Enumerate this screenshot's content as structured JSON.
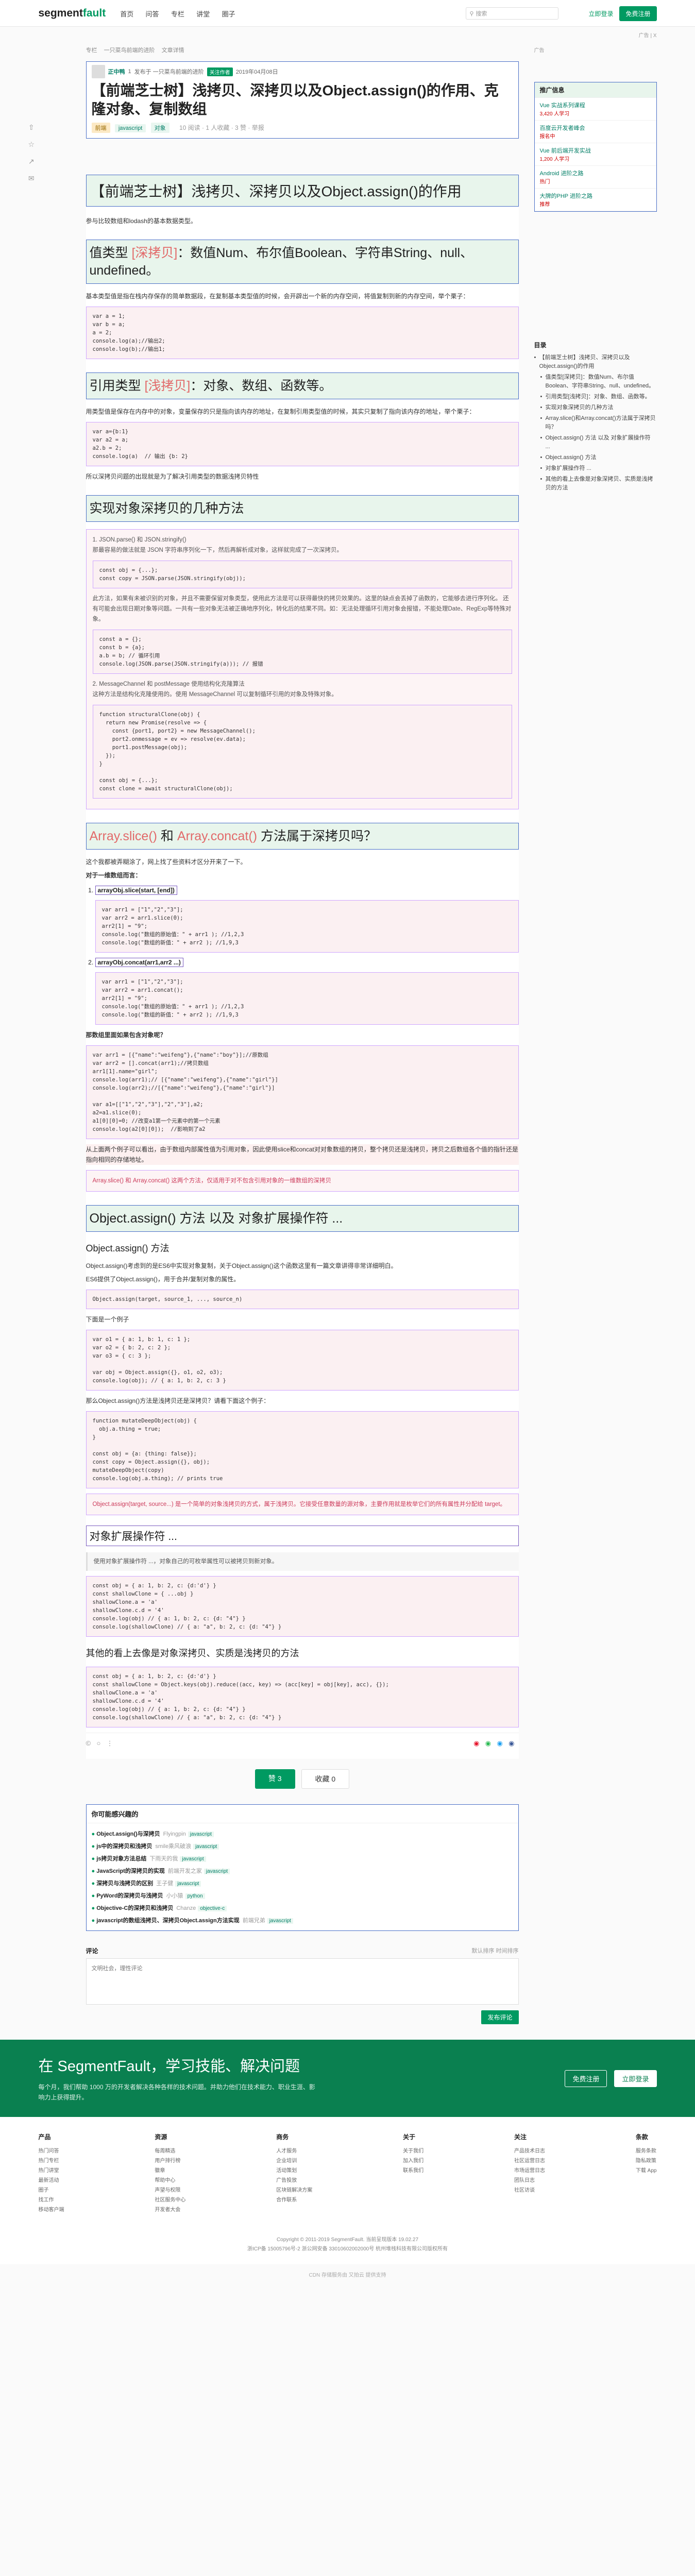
{
  "header": {
    "logo_a": "segment",
    "logo_b": "fault",
    "nav": [
      "首页",
      "问答",
      "专栏",
      "讲堂",
      "圈子"
    ],
    "search_placeholder": "搜索",
    "login": "立即登录",
    "register": "免费注册",
    "ad_tip": "广告 | X"
  },
  "crumb": [
    "专栏",
    "一只菜鸟前端的进阶",
    "文章详情"
  ],
  "post": {
    "author": "正中鸭",
    "rep": "1",
    "follow": "关注作者",
    "meta": "发布于 一只菜鸟前端的进阶",
    "date": "2019年04月08日",
    "title": "【前端芝士树】浅拷贝、深拷贝以及Object.assign()的作用、克隆对象、复制数组",
    "tags": [
      "前端",
      "javascript",
      "对象"
    ],
    "stats": "10 阅读  · 1 人收藏 · 3 赞  · 举报"
  },
  "article": {
    "h1": "【前端芝士树】浅拷贝、深拷贝以及Object.assign()的作用",
    "intro": "参与比较数组和lodash的基本数据类型。",
    "s1_title": "值类型 ",
    "s1_hl": "[深拷贝]",
    "s1_rest": "：数值Num、布尔值Boolean、字符串String、null、undefined。",
    "s1_text": "基本类型值是指在栈内存保存的简单数据段，在复制基本类型值的时候，会开辟出一个新的内存空间，将值复制到新的内存空间，举个栗子：",
    "s1_code": "var a = 1;\nvar b = a;\na = 2;\nconsole.log(a);//输出2;\nconsole.log(b);//输出1;",
    "s2_title": "引用类型 ",
    "s2_hl": "[浅拷贝]",
    "s2_rest": "：对象、数组、函数等。",
    "s2_text": "用类型值是保存在内存中的对象，变量保存的只是指向该内存的地址，在复制引用类型值的时候，其实只复制了指向该内存的地址，举个栗子：",
    "s2_code": "var a={b:1}\nvar a2 = a;\na2.b = 2;\nconsole.log(a)  // 输出 {b: 2}",
    "s2_after": "所以深拷贝问题的出现就是为了解决引用类型的数据浅拷贝特性",
    "s3_title": "实现对象深拷贝的几种方法",
    "s3_q1": "1. JSON.parse() 和 JSON.stringify()\n那最容易的做法就是 JSON 字符串序列化一下，然后再解析成对象，这样就完成了一次深拷贝。",
    "s3_code1": "const obj = {...};\nconst copy = JSON.parse(JSON.stringify(obj));",
    "s3_q2": "此方法，如果有未被识别的对象，并且不需要保留对象类型，使用此方法是可以获得最快的拷贝效果的。这里的缺点会丢掉了函数的，它能够去进行序列化。 还有可能会出现日期对象等问题。一共有一些对象无法被正确地序列化，转化后的结果不同。如：无法处理循环引用对象会报错，不能处理Date、RegExp等特殊对象。",
    "s3_code2": "const a = {};\nconst b = {a};\na.b = b; // 循环引用\nconsole.log(JSON.parse(JSON.stringify(a))); // 报错",
    "s3_q3": "2. MessageChannel 和 postMessage 使用结构化克隆算法\n这种方法是结构化克隆使用的。使用 MessageChannel 可以复制循环引用的对象及特殊对象。",
    "s3_code3": "function structuralClone(obj) {\n  return new Promise(resolve => {\n    const {port1, port2} = new MessageChannel();\n    port2.onmessage = ev => resolve(ev.data);\n    port1.postMessage(obj);\n  });\n}\n\nconst obj = {...};\nconst clone = await structuralClone(obj);",
    "s4_title_a": "Array.slice()",
    "s4_mid": " 和 ",
    "s4_title_b": "Array.concat()",
    "s4_rest": " 方法属于深拷贝吗？",
    "s4_text": "这个我都被弄糊涂了，网上找了些资料才区分开来了一下。",
    "s4_text2": "对于一维数组而言：",
    "s4_item1": "arrayObj.slice(start, [end])",
    "s4_code1": "var arr1 = [\"1\",\"2\",\"3\"];\nvar arr2 = arr1.slice(0);\narr2[1] = \"9\";\nconsole.log(\"数组的原始值：\" + arr1 ); //1,2,3\nconsole.log(\"数组的新值：\" + arr2 ); //1,9,3",
    "s4_item2": "arrayObj.concat(arr1,arr2 ...)",
    "s4_code2": "var arr1 = [\"1\",\"2\",\"3\"];\nvar arr2 = arr1.concat();\narr2[1] = \"9\";\nconsole.log(\"数组的原始值：\" + arr1 ); //1,2,3\nconsole.log(\"数组的新值：\" + arr2 ); //1,9,3",
    "s4_text3": "那数组里面如果包含对象呢？",
    "s4_code3": "var arr1 = [{\"name\":\"weifeng\"},{\"name\":\"boy\"}];//原数组\nvar arr2 = [].concat(arr1);//拷贝数组\narr1[1].name=\"girl\";\nconsole.log(arr1);// [{\"name\":\"weifeng\"},{\"name\":\"girl\"}]\nconsole.log(arr2);//[{\"name\":\"weifeng\"},{\"name\":\"girl\"}]\n\nvar a1=[[\"1\",\"2\",\"3\"],\"2\",\"3\"],a2;\na2=a1.slice(0);\na1[0][0]=0; //改变a1第一个元素中的第一个元素\nconsole.log(a2[0][0]);  //影响到了a2",
    "s4_text4": "从上面两个例子可以看出，由于数组内部属性值为引用对象，因此使用slice和concat对对象数组的拷贝，整个拷贝还是浅拷贝，拷贝之后数组各个值的指针还是指向相同的存储地址。",
    "s4_tip": "Array.slice() 和 Array.concat() 这两个方法，仅适用于对不包含引用对象的一维数组的深拷贝",
    "s5_title": "Object.assign() 方法 以及 对象扩展操作符 ...",
    "s5_sub": "Object.assign() 方法",
    "s5_text": "Object.assign()考虑到的是ES6中实现对象复制，关于Object.assign()这个函数这里有一篇文章讲得非常详细明白。",
    "s5_text2": "ES6提供了Object.assign()，用于合并/复制对象的属性。",
    "s5_code1": "Object.assign(target, source_1, ..., source_n)",
    "s5_text3": "下面是一个例子",
    "s5_code2": "var o1 = { a: 1, b: 1, c: 1 };\nvar o2 = { b: 2, c: 2 };\nvar o3 = { c: 3 };\n\nvar obj = Object.assign({}, o1, o2, o3);\nconsole.log(obj); // { a: 1, b: 2, c: 3 }",
    "s5_text4": "那么Object.assign()方法是浅拷贝还是深拷贝？请看下面这个例子：",
    "s5_code3": "function mutateDeepObject(obj) {\n  obj.a.thing = true;\n}\n\nconst obj = {a: {thing: false}};\nconst copy = Object.assign({}, obj);\nmutateDeepObject(copy)\nconsole.log(obj.a.thing); // prints true",
    "s5_tip": "Object.assign(target, source...) 是一个简单的对象浅拷贝的方式，属于浅拷贝。它接受任意数量的源对象，主要作用就是枚举它们的所有属性并分配给 target。",
    "s6_title": "对象扩展操作符 ...",
    "s6_q": "使用对象扩展操作符 ...，对象自己的可枚举属性可以被拷贝到新对象。",
    "s6_code": "const obj = { a: 1, b: 2, c: {d:'d'} }\nconst shallowClone = { ...obj }\nshallowClone.a = 'a'\nshallowClone.c.d = '4'\nconsole.log(obj) // { a: 1, b: 2, c: {d: \"4\"} }\nconsole.log(shallowClone) // { a: \"a\", b: 2, c: {d: \"4\"} }",
    "s7_title": "其他的看上去像是对象深拷贝、实质是浅拷贝的方法",
    "s7_code": "const obj = { a: 1, b: 2, c: {d:'d'} }\nconst shallowClone = Object.keys(obj).reduce((acc, key) => (acc[key] = obj[key], acc), {});\nshallowClone.a = 'a'\nshallowClone.c.d = '4'\nconsole.log(obj) // { a: 1, b: 2, c: {d: \"4\"} }\nconsole.log(shallowClone) // { a: \"a\", b: 2, c: {d: \"4\"} }"
  },
  "actions": {
    "vote": "赞 3",
    "fav": "收藏 0"
  },
  "related": {
    "title": "你可能感兴趣的",
    "items": [
      {
        "t": "Object.assign()与深拷贝",
        "a": "Flyingpin",
        "tag": "javascript"
      },
      {
        "t": "js中的深拷贝和浅拷贝",
        "a": "smile乘风破浪",
        "tag": "javascript"
      },
      {
        "t": "js拷贝对象方法总结",
        "a": "下雨天的我",
        "tag": "javascript"
      },
      {
        "t": "JavaScript的深拷贝的实现",
        "a": "前端开发之家",
        "tag": "javascript"
      },
      {
        "t": "深拷贝与浅拷贝的区别",
        "a": "王子健",
        "tag": "javascript"
      },
      {
        "t": "PyWord的深拷贝与浅拷贝",
        "a": "小小猿",
        "tag": "python"
      },
      {
        "t": "Objective-C的深拷贝和浅拷贝",
        "a": "Chanze",
        "tag": "objective-c"
      },
      {
        "t": "javascript的数组浅拷贝、深拷贝Object.assign方法实现",
        "a": "前端兄弟",
        "tag": "javascript"
      }
    ]
  },
  "comment": {
    "title": "评论",
    "sort": "默认排序 时间排序",
    "placeholder": "文明社会，理性评论",
    "publish": "发布评论"
  },
  "side": {
    "ad": "广告",
    "rec_title": "推广信息",
    "rec": [
      {
        "t": "Vue 实战系列课程",
        "s": "3,420 人学习"
      },
      {
        "t": "百度云开发者峰会",
        "s": "报名中"
      },
      {
        "t": "Vue 前后端开发实战",
        "s": "1,200 人学习"
      },
      {
        "t": "Android 进阶之路",
        "s": "热门"
      },
      {
        "t": "大牌的PHP 进阶之路",
        "s": "推荐"
      }
    ],
    "toc_title": "目录",
    "toc": [
      {
        "t": "【前端芝士树】浅拷贝、深拷贝以及Object.assign()的作用",
        "sub": false
      },
      {
        "t": "值类型[深拷贝]：数值Num、布尔值Boolean、字符串String、null、undefined。",
        "sub": true
      },
      {
        "t": "引用类型[浅拷贝]：对象、数组、函数等。",
        "sub": true
      },
      {
        "t": "实现对象深拷贝的几种方法",
        "sub": true
      },
      {
        "t": "Array.slice()和Array.concat()方法属于深拷贝吗？",
        "sub": true
      },
      {
        "t": "Object.assign() 方法 以及 对象扩展操作符 ...",
        "sub": true
      },
      {
        "t": "Object.assign() 方法",
        "sub": true
      },
      {
        "t": "对象扩展操作符 ...",
        "sub": true
      },
      {
        "t": "其他的看上去像是对象深拷贝、实质是浅拷贝的方法",
        "sub": true
      }
    ]
  },
  "banner": {
    "title": "在 SegmentFault，学习技能、解决问题",
    "text": "每个月，我们帮助 1000 万的开发者解决各种各样的技术问题。并助力他们在技术能力、职业生涯、影响力上获得提升。",
    "btn1": "免费注册",
    "btn2": "立即登录"
  },
  "footer": {
    "cols": [
      {
        "h": "产品",
        "l": [
          "热门问答",
          "热门专栏",
          "热门讲堂",
          "最新活动",
          "圈子",
          "找工作",
          "移动客户端"
        ]
      },
      {
        "h": "资源",
        "l": [
          "每周精选",
          "用户排行榜",
          "徽章",
          "帮助中心",
          "声望与权限",
          "社区服务中心",
          "开发者大会"
        ]
      },
      {
        "h": "商务",
        "l": [
          "人才服务",
          "企业培训",
          "活动策划",
          "广告投放",
          "区块链解决方案",
          "合作联系"
        ]
      },
      {
        "h": "关于",
        "l": [
          "关于我们",
          "加入我们",
          "联系我们"
        ]
      },
      {
        "h": "关注",
        "l": [
          "产品技术日志",
          "社区运营日志",
          "市场运营日志",
          "团队日志",
          "社区访谈"
        ]
      },
      {
        "h": "条款",
        "l": [
          "服务条款",
          "隐私政策",
          "下载 App"
        ]
      }
    ],
    "copy1": "Copyright © 2011-2019 SegmentFault. 当前呈现版本 19.02.27",
    "copy2": "浙ICP备 15005796号-2  浙公网安备 33010602002000号  杭州堆栈科技有限公司版权所有",
    "bottom": "CDN 存储服务由 又拍云 提供支持"
  }
}
